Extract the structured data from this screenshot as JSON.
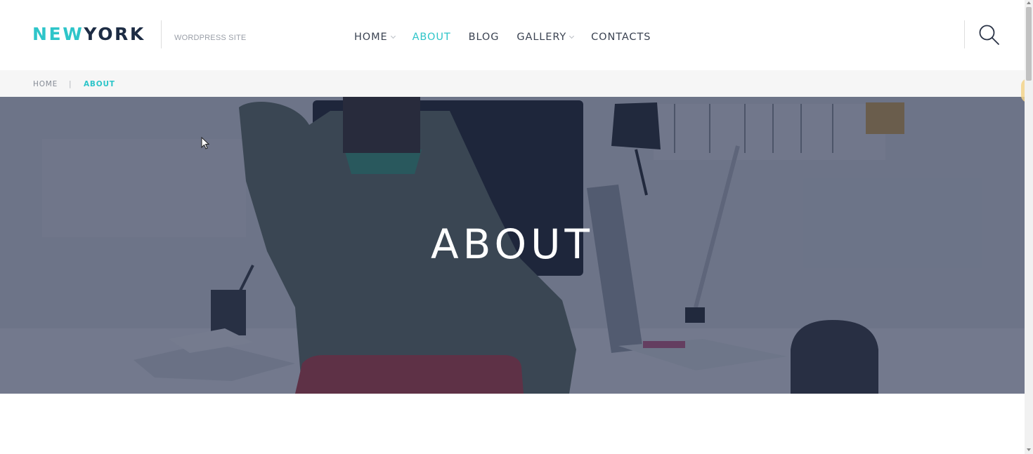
{
  "site": {
    "logo_part1": "NEW",
    "logo_part2": "YORK",
    "tagline": "WORDPRESS SITE"
  },
  "nav": {
    "items": [
      {
        "label": "HOME",
        "has_dropdown": true,
        "active": false
      },
      {
        "label": "ABOUT",
        "has_dropdown": false,
        "active": true
      },
      {
        "label": "BLOG",
        "has_dropdown": false,
        "active": false
      },
      {
        "label": "GALLERY",
        "has_dropdown": true,
        "active": false
      },
      {
        "label": "CONTACTS",
        "has_dropdown": false,
        "active": false
      }
    ],
    "search_icon": "search-icon"
  },
  "breadcrumb": {
    "home": "HOME",
    "separator": "|",
    "current": "ABOUT"
  },
  "hero": {
    "title": "ABOUT"
  },
  "colors": {
    "accent": "#2ec5c9",
    "dark": "#1d2c44",
    "overlay": "#26314e"
  }
}
